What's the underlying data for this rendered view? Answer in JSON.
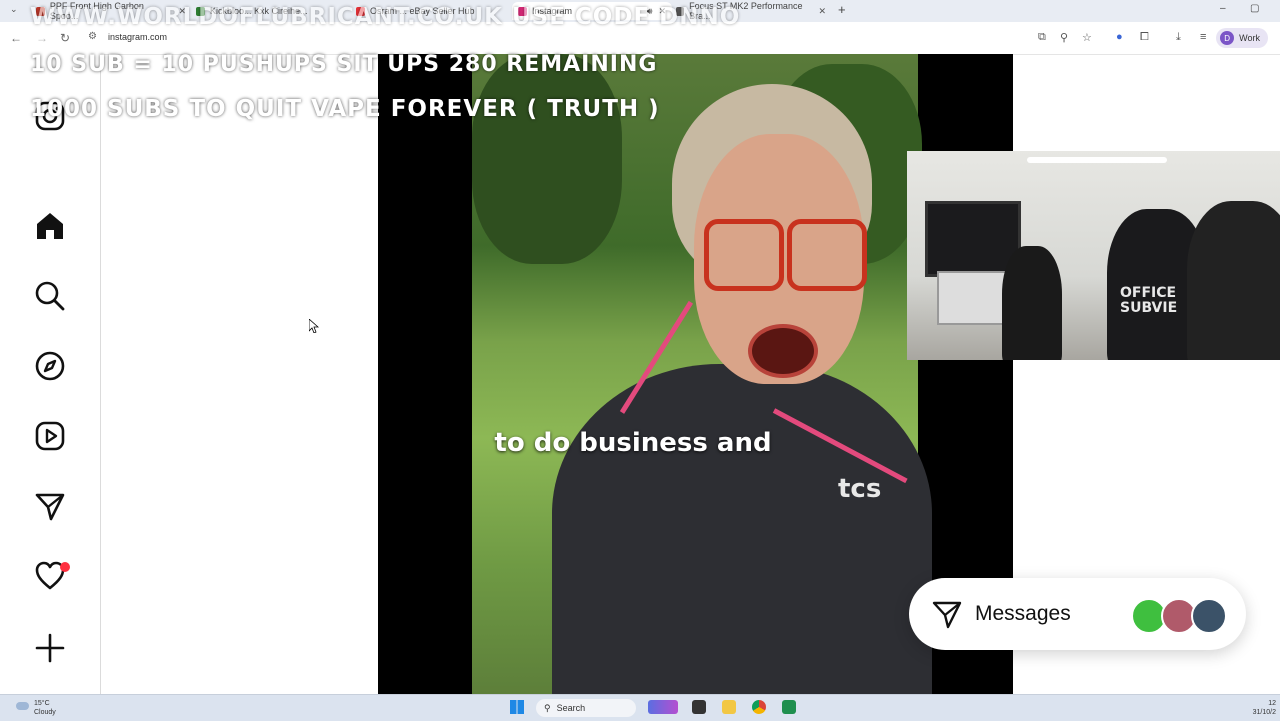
{
  "browser": {
    "tabs": [
      {
        "label": "PPF Front High Carbon Spoo...",
        "active": false,
        "color": "#c0392b"
      },
      {
        "label": "Kickbloo... Kxk Cireihe...",
        "active": false,
        "color": "#2e7d32"
      },
      {
        "label": "Osram ... eBay Seller Hub",
        "active": false,
        "color": "#e53238"
      },
      {
        "label": "Instagram",
        "active": true,
        "color": "#d62976"
      },
      {
        "label": "Focus ST MK2 Performance Bra...",
        "active": false,
        "color": "#555555"
      }
    ],
    "new_tab": "+",
    "url": "instagram.com",
    "profile_initial": "D",
    "profile_label": "Work"
  },
  "overlay": {
    "line1": "WWW.WORLDOFLUBRICANT.CO.UK USE CODE DNNO",
    "line2": "10 SUB = 10 PUSHUPS SIT UPS 280 REMAINING",
    "line3": "1000 SUBS TO QUIT VAPE FOREVER ( TRUTH )"
  },
  "sidebar": {
    "items": [
      {
        "icon": "instagram-logo-icon"
      },
      {
        "icon": "home-icon"
      },
      {
        "icon": "search-icon"
      },
      {
        "icon": "explore-icon"
      },
      {
        "icon": "reels-icon"
      },
      {
        "icon": "messages-icon"
      },
      {
        "icon": "notifications-icon"
      },
      {
        "icon": "create-icon"
      }
    ]
  },
  "reel": {
    "caption": "to do business and",
    "jacket_brand": "tcs"
  },
  "webcam": {
    "hoodie_text": "OFFICE\nSUBVIE"
  },
  "messages": {
    "label": "Messages",
    "avatar_colors": [
      "#3fbf3f",
      "#b05a6a",
      "#3b5268"
    ]
  },
  "taskbar": {
    "weather_temp": "15°C",
    "weather_desc": "Cloudy",
    "search_label": "Search",
    "time": "12",
    "date": "31/10/2"
  },
  "colors": {
    "accent_pink": "#e34a7d",
    "notification_red": "#ff3040",
    "glasses_red": "#c8321e"
  }
}
